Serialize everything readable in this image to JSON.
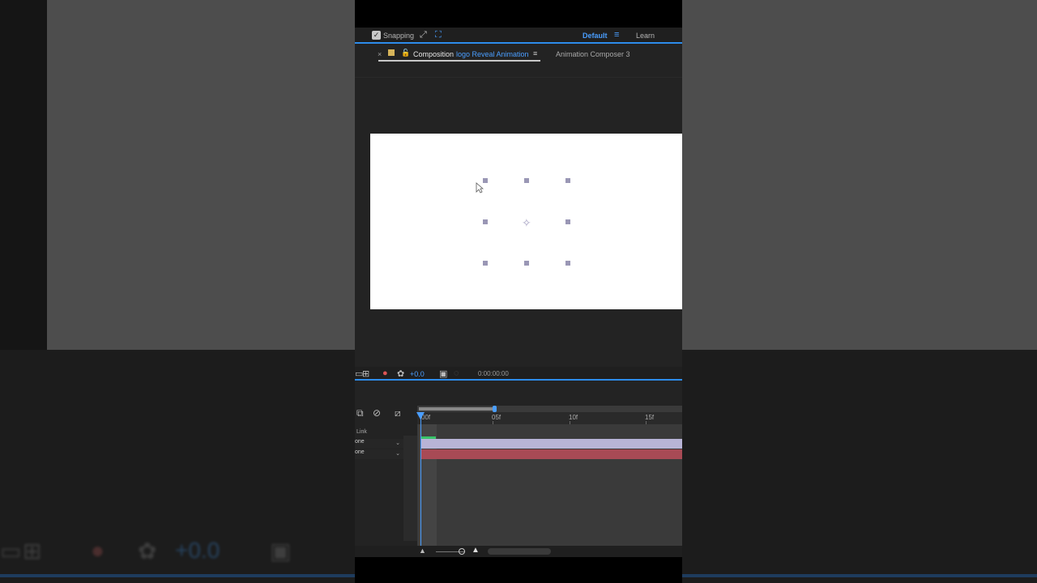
{
  "toolbar": {
    "snapping_label": "Snapping",
    "snapping_checked": "✓",
    "workspace_default": "Default",
    "workspace_learn": "Learn"
  },
  "composition_tab": {
    "close": "×",
    "label": "Composition",
    "name": "logo Reveal Animation",
    "other_tab": "Animation Composer 3"
  },
  "viewer_bar": {
    "exposure": "+0.0",
    "timecode": "0:00:00:00"
  },
  "timeline": {
    "ruler_ticks": [
      "00f",
      "05f",
      "10f",
      "15f"
    ],
    "link_label": "Link",
    "layers": [
      {
        "parent": "one"
      },
      {
        "parent": "one"
      }
    ]
  },
  "background_ghost": {
    "exposure": "+0.0"
  },
  "colors": {
    "accent_blue": "#2d8ceb",
    "layer_purple": "#b8b4d6",
    "layer_red": "#a84a55",
    "work_area_green": "#39c46a",
    "label_yellow": "#d6b45a"
  }
}
